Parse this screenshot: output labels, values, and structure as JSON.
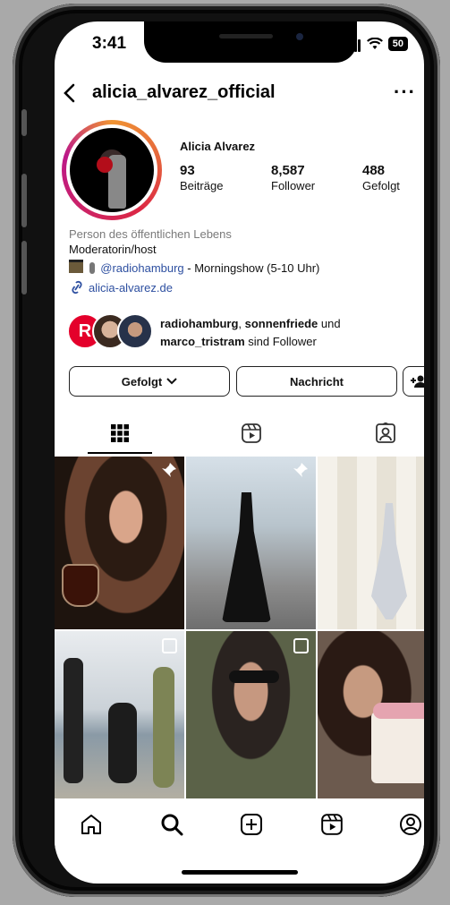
{
  "status": {
    "time": "3:41",
    "battery": "50"
  },
  "header": {
    "username": "alicia_alvarez_official",
    "back_icon": "chevron-left-icon",
    "more_icon": "more-horizontal-icon",
    "more_glyph": "···",
    "back_glyph": "‹"
  },
  "profile": {
    "name": "Alicia Alvarez",
    "stats": [
      {
        "value": "93",
        "label": "Beiträge"
      },
      {
        "value": "8,587",
        "label": "Follower"
      },
      {
        "value": "488",
        "label": "Gefolgt"
      }
    ],
    "category": "Person des öffentlichen Lebens",
    "bio_line1": "Moderatorin/host",
    "bio_mention": "@radiohamburg",
    "bio_rest": " - Morningshow (5-10 Uhr)",
    "link": "alicia-alvarez.de"
  },
  "followed_by": {
    "badge_letter": "R",
    "account1": "radiohamburg",
    "sep1": ", ",
    "account2": "sonnenfriede",
    "sep2": " und",
    "account3": "marco_tristram",
    "suffix": " sind Follower"
  },
  "actions": {
    "following_label": "Gefolgt",
    "message_label": "Nachricht"
  },
  "colors": {
    "link": "#2d4fa0",
    "category": "#7a7a7a",
    "accent_red": "#e4002b"
  }
}
